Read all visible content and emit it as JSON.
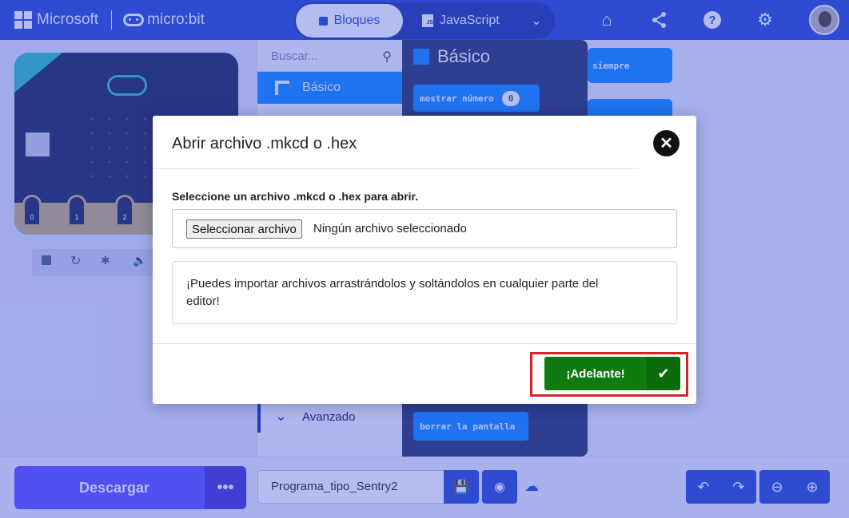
{
  "header": {
    "brand_microsoft": "Microsoft",
    "brand_microbit": "micro:bit",
    "tabs": [
      {
        "label": "Bloques",
        "active": true
      },
      {
        "label": "JavaScript",
        "active": false
      }
    ],
    "icons": [
      "home-icon",
      "share-icon",
      "help-icon",
      "settings-icon"
    ]
  },
  "toolbox": {
    "search_placeholder": "Buscar...",
    "categories": [
      {
        "label": "Básico",
        "color": "#1e90ff"
      }
    ],
    "advanced_label": "Avanzado"
  },
  "flyout": {
    "title": "Básico",
    "blocks": [
      {
        "text": "mostrar número",
        "value": "0"
      },
      {
        "text": "borrar la pantalla"
      }
    ]
  },
  "workspace": {
    "blocks": [
      "siempre"
    ]
  },
  "simulator": {
    "pins": [
      "0",
      "1",
      "2"
    ]
  },
  "bottombar": {
    "download_label": "Descargar",
    "more_label": "•••",
    "project_name": "Programa_tipo_Sentry2"
  },
  "modal": {
    "title": "Abrir archivo .mkcd o .hex",
    "file_label": "Seleccione un archivo .mkcd o .hex para abrir.",
    "file_button": "Seleccionar archivo",
    "file_status": "Ningún archivo seleccionado",
    "hint": "¡Puedes importar archivos arrastrándolos y soltándolos en cualquier parte del editor!",
    "go_label": "¡Adelante!"
  },
  "colors": {
    "primary": "#3454d1",
    "download": "#6a5cff",
    "go": "#0f7b0f",
    "highlight": "#d32626"
  }
}
